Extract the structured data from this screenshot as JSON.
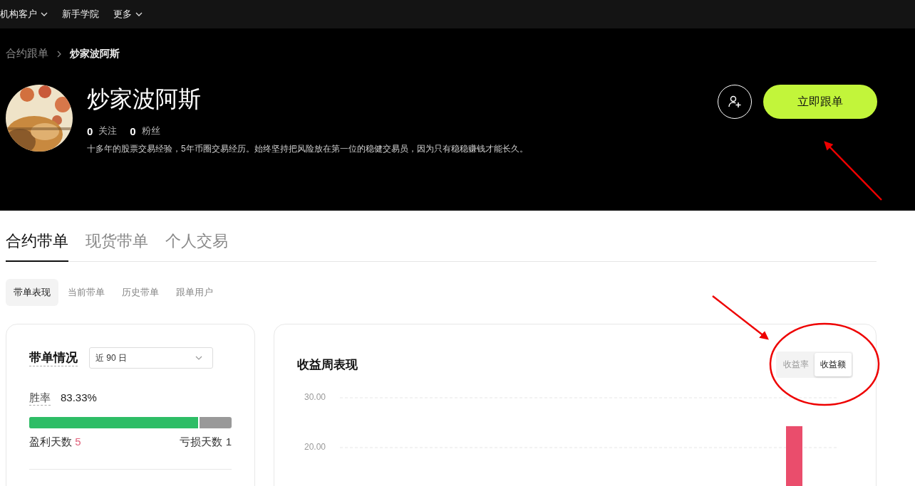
{
  "nav": [
    {
      "label": "机构客户",
      "has_caret": true
    },
    {
      "label": "新手学院",
      "has_caret": false
    },
    {
      "label": "更多",
      "has_caret": true
    }
  ],
  "breadcrumb": [
    {
      "label": "合约跟单"
    },
    {
      "label": "炒家波阿斯"
    }
  ],
  "profile": {
    "kind": "picture",
    "name": "炒家波阿斯",
    "following_count": "0",
    "following_label": "关注",
    "followers_count": "0",
    "followers_label": "粉丝",
    "bio": "十多年的股票交易经验，5年币圈交易经历。始终坚持把风险放在第一位的稳健交易员，因为只有稳稳赚钱才能长久。",
    "follow_button": "立即跟单"
  },
  "tabs": [
    {
      "label": "合约带单",
      "selected": true
    },
    {
      "label": "现货带单",
      "selected": false
    },
    {
      "label": "个人交易",
      "selected": false
    }
  ],
  "subtabs": [
    {
      "label": "带单表现",
      "selected": true
    },
    {
      "label": "当前带单",
      "selected": false
    },
    {
      "label": "历史带单",
      "selected": false
    },
    {
      "label": "跟单用户",
      "selected": false
    }
  ],
  "summary": {
    "title": "带单情况",
    "period": "近 90 日",
    "win_rate_label": "胜率",
    "win_rate": "83.33%",
    "level": 0.8333,
    "profit_days_label": "盈利天数",
    "profit_days": "5",
    "loss_days_label": "亏损天数",
    "loss_days": "1"
  },
  "weekly": {
    "title": "收益周表现",
    "toggle": [
      {
        "label": "收益率",
        "selected": false
      },
      {
        "label": "收益额",
        "selected": true
      }
    ],
    "chart_data": {
      "type": "bar",
      "ylim": [
        0,
        30
      ],
      "yticks": [
        {
          "value": 20,
          "label": "20.00"
        },
        {
          "value": 30,
          "label": "30.00"
        }
      ],
      "values": [
        24.3
      ]
    }
  }
}
